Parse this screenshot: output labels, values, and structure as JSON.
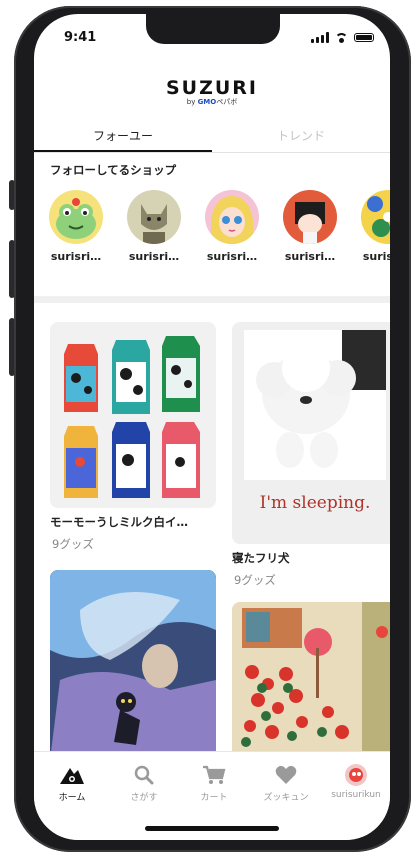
{
  "status_bar": {
    "time": "9:41"
  },
  "brand": {
    "logo": "SUZURI",
    "sub_prefix": "by ",
    "sub_brand": "GMO",
    "sub_suffix": "ペパボ"
  },
  "tabs": [
    {
      "label": "フォーユー",
      "active": true
    },
    {
      "label": "トレンド",
      "active": false
    }
  ],
  "follow_section": {
    "title": "フォローしてるショップ",
    "shops": [
      {
        "name": "surisri…",
        "has_update": true,
        "avatar": "frog-avatar"
      },
      {
        "name": "surisri…",
        "has_update": true,
        "avatar": "cat-avatar"
      },
      {
        "name": "surisri…",
        "has_update": false,
        "avatar": "doll-avatar"
      },
      {
        "name": "surisri…",
        "has_update": false,
        "avatar": "girl-avatar"
      },
      {
        "name": "surisri…",
        "has_update": false,
        "avatar": "pattern-avatar"
      }
    ]
  },
  "items": [
    {
      "title": "モーモーうしミルク白イ…",
      "count": "9グッズ",
      "image": "milk-cartons"
    },
    {
      "title": "寝たフリ犬",
      "count": "9グッズ",
      "image": "sleeping-dog",
      "image_text": "I'm sleeping."
    },
    {
      "title": "",
      "count": "",
      "image": "night-cat-illustration"
    },
    {
      "title": "",
      "count": "",
      "image": "flower-garden-illustration"
    }
  ],
  "bottom_nav": [
    {
      "label": "ホーム",
      "icon": "home-icon",
      "active": true
    },
    {
      "label": "さがす",
      "icon": "search-icon",
      "active": false
    },
    {
      "label": "カート",
      "icon": "cart-icon",
      "active": false
    },
    {
      "label": "ズッキュン",
      "icon": "heart-icon",
      "active": false
    },
    {
      "label": "surisurikun",
      "icon": "profile-avatar",
      "active": false
    }
  ],
  "colors": {
    "accent_dot": "#2fd4e8",
    "brand_blue": "#1b4fbf"
  }
}
